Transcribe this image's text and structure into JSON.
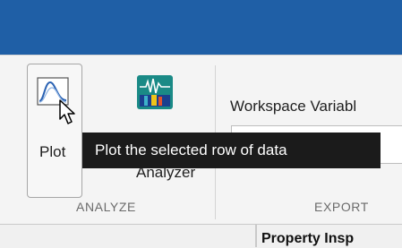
{
  "toolstrip": {
    "analyze_group": {
      "plot_button": {
        "label": "Plot",
        "icon": "line-plot-icon"
      },
      "analyzer_button": {
        "label": "Analyzer",
        "icon": "signal-spectrogram-icon"
      },
      "group_label": "ANALYZE"
    },
    "export_group": {
      "workspace_label": "Workspace Variabl",
      "workspace_value": "",
      "group_label": "EXPORT"
    }
  },
  "tooltip": {
    "text": "Plot the selected row of data"
  },
  "property_inspector": {
    "title": "Property Insp"
  },
  "colors": {
    "title_bar": "#1f5fa6",
    "toolstrip_bg": "#f4f4f4",
    "tooltip_bg": "#1b1b1b",
    "analyzer_icon_bg": "#1a8a86"
  }
}
